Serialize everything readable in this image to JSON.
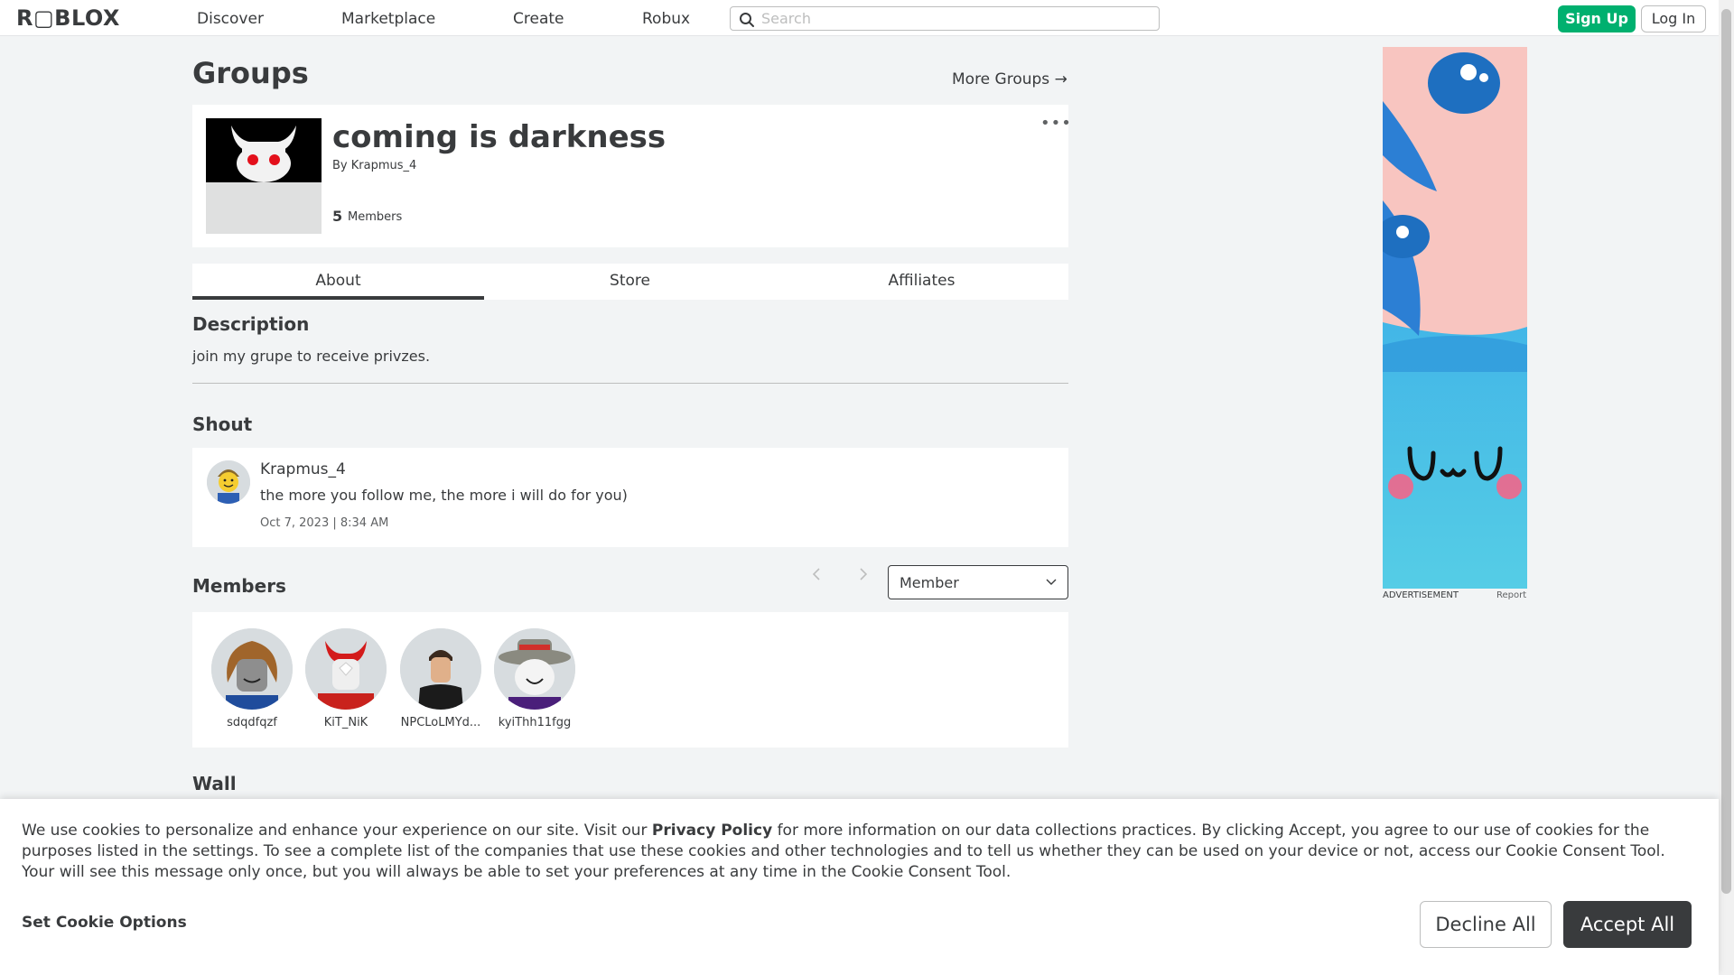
{
  "nav": {
    "logo": "R▢BLOX",
    "links": [
      "Discover",
      "Marketplace",
      "Create",
      "Robux"
    ],
    "search_placeholder": "Search",
    "signup_label": "Sign Up",
    "login_label": "Log In"
  },
  "header": {
    "title": "Groups",
    "more_groups": "More Groups →"
  },
  "group": {
    "name": "coming is darkness",
    "by_label": "By",
    "owner": "Krapmus_4",
    "member_count": "5",
    "member_label": "Members",
    "menu_icon": "more-dots-icon"
  },
  "tabs": [
    "About",
    "Store",
    "Affiliates"
  ],
  "about": {
    "description_heading": "Description",
    "description": "join my grupe to receive privzes.",
    "shout_heading": "Shout",
    "shout": {
      "user": "Krapmus_4",
      "text": "the more you follow me, the more i will do for you)",
      "date": "Oct 7, 2023 | 8:34 AM"
    }
  },
  "members_section": {
    "heading": "Members",
    "role_selected": "Member",
    "members": [
      "sdqdfqzf",
      "KiT_NiK",
      "NPCLoLMYd...",
      "kyiThh11fgg"
    ]
  },
  "wall": {
    "heading": "Wall"
  },
  "ad": {
    "label": "ADVERTISEMENT",
    "report": "Report",
    "face_text": "UwU"
  },
  "cookie": {
    "text_before": "We use cookies to personalize and enhance your experience on our site. Visit our ",
    "privacy_link": "Privacy Policy",
    "text_after": " for more information on our data collections practices. By clicking Accept, you agree to our use of cookies for the purposes listed in the settings. To see a complete list of the companies that use these cookies and other technologies and to tell us whether they can be used on your device or not, access our Cookie Consent Tool. Your will see this message only once, but you will always be able to set your preferences at any time in the Cookie Consent Tool.",
    "options_label": "Set Cookie Options",
    "decline_label": "Decline All",
    "accept_label": "Accept All"
  },
  "colors": {
    "signup_green": "#00b06f",
    "text_dark": "#393b3d",
    "background": "#f2f4f5"
  }
}
